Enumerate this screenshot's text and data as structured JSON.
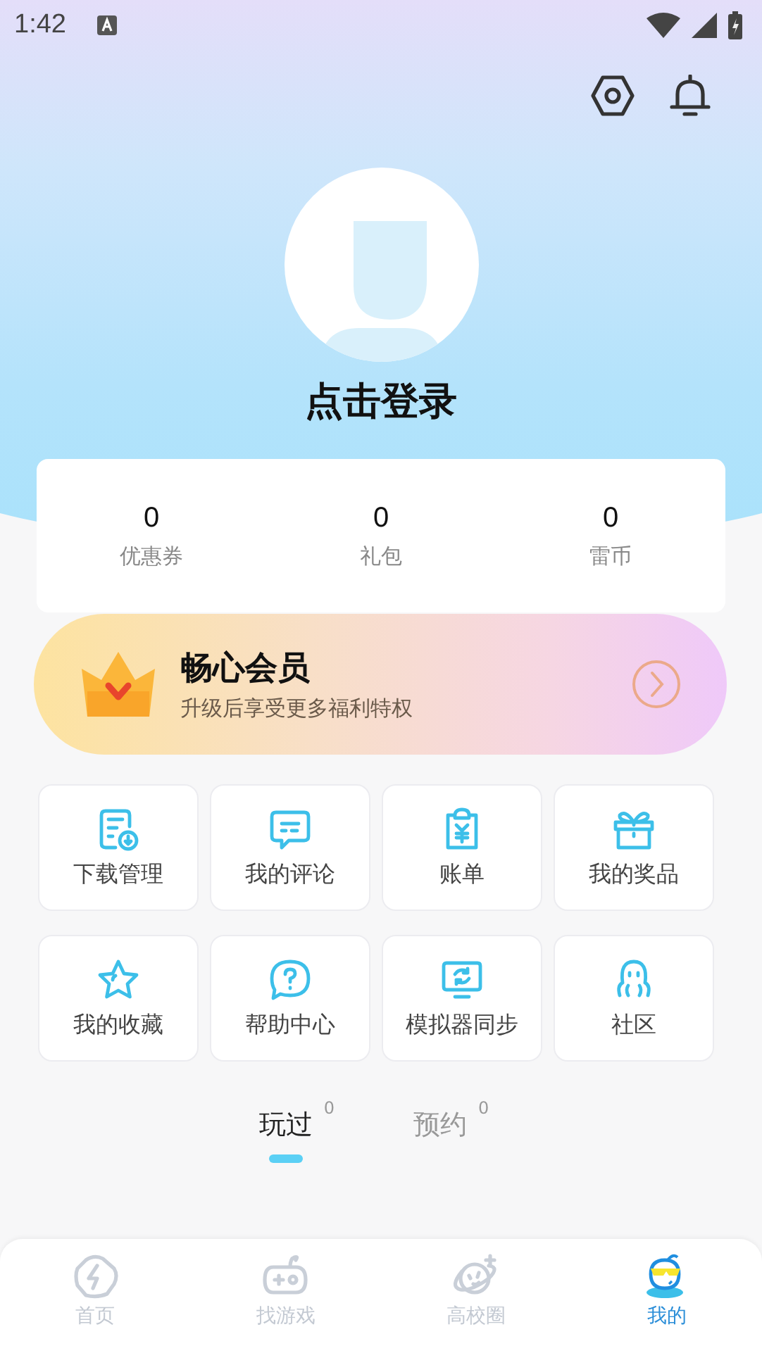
{
  "status_bar": {
    "time": "1:42"
  },
  "profile": {
    "login_label": "点击登录"
  },
  "stats": [
    {
      "value": "0",
      "label": "优惠券"
    },
    {
      "value": "0",
      "label": "礼包"
    },
    {
      "value": "0",
      "label": "雷币"
    }
  ],
  "vip": {
    "title": "畅心会员",
    "subtitle": "升级后享受更多福利特权"
  },
  "shortcuts": [
    {
      "label": "下载管理",
      "kind": "download"
    },
    {
      "label": "我的评论",
      "kind": "comment"
    },
    {
      "label": "账单",
      "kind": "bill"
    },
    {
      "label": "我的奖品",
      "kind": "gift"
    },
    {
      "label": "我的收藏",
      "kind": "star"
    },
    {
      "label": "帮助中心",
      "kind": "help"
    },
    {
      "label": "模拟器同步",
      "kind": "sync"
    },
    {
      "label": "社区",
      "kind": "community"
    }
  ],
  "tabs": [
    {
      "label": "玩过",
      "count": "0",
      "selected": true
    },
    {
      "label": "预约",
      "count": "0",
      "selected": false
    }
  ],
  "nav": [
    {
      "label": "首页",
      "kind": "home",
      "selected": false
    },
    {
      "label": "找游戏",
      "kind": "games",
      "selected": false
    },
    {
      "label": "高校圈",
      "kind": "planet",
      "selected": false
    },
    {
      "label": "我的",
      "kind": "me",
      "selected": true
    }
  ]
}
